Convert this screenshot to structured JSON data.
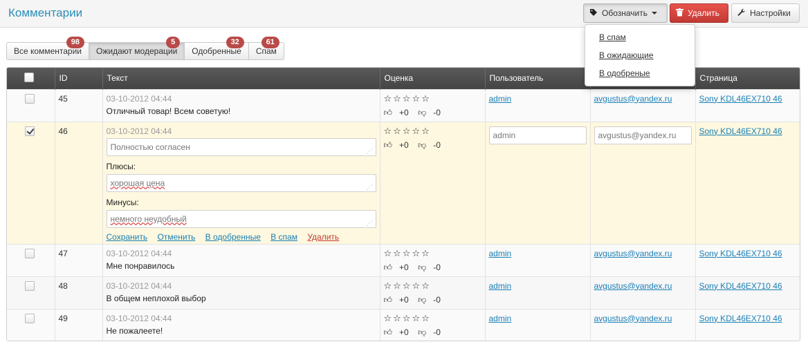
{
  "header": {
    "title": "Комментарии",
    "mark_label": "Обозначить",
    "delete_label": "Удалить",
    "settings_label": "Настройки"
  },
  "dropdown": {
    "items": [
      "В спам",
      "В ожидающие",
      "В одобреные"
    ]
  },
  "tabs": [
    {
      "label": "Все комментарии",
      "count": "98"
    },
    {
      "label": "Ожидают модерации",
      "count": "5"
    },
    {
      "label": "Одобренные",
      "count": "32"
    },
    {
      "label": "Спам",
      "count": "61"
    }
  ],
  "table": {
    "columns": [
      "ID",
      "Текст",
      "Оценка",
      "Пользователь",
      "",
      "Страница"
    ],
    "rows": [
      {
        "id": "45",
        "date": "03-10-2012 04:44",
        "text": "Отличный товар! Всем советую!",
        "stars": "☆☆☆☆☆",
        "up": "+0",
        "down": "-0",
        "user": "admin",
        "email": "avgustus@yandex.ru",
        "page": "Sony KDL46EX710 46"
      },
      {
        "id": "46",
        "date": "03-10-2012 04:44",
        "stars": "☆☆☆☆☆",
        "up": "+0",
        "down": "-0",
        "page": "Sony KDL46EX710 46"
      },
      {
        "id": "47",
        "date": "03-10-2012 04:44",
        "text": "Мне понравилось",
        "stars": "☆☆☆☆☆",
        "up": "+0",
        "down": "-0",
        "user": "admin",
        "email": "avgustus@yandex.ru",
        "page": "Sony KDL46EX710 46"
      },
      {
        "id": "48",
        "date": "03-10-2012 04:44",
        "text": "В общем неплохой выбор",
        "stars": "☆☆☆☆☆",
        "up": "+0",
        "down": "-0",
        "user": "admin",
        "email": "avgustus@yandex.ru",
        "page": "Sony KDL46EX710 46"
      },
      {
        "id": "49",
        "date": "03-10-2012 04:44",
        "text": "Не пожалеете!",
        "stars": "☆☆☆☆☆",
        "up": "+0",
        "down": "-0",
        "user": "admin",
        "email": "avgustus@yandex.ru",
        "page": "Sony KDL46EX710 46"
      }
    ],
    "edit": {
      "text_value": "Полностью согласен",
      "pros_label": "Плюсы:",
      "pros_value": "хорошая цена",
      "cons_label": "Минусы:",
      "cons_value": "немного неудобный",
      "user_value": "admin",
      "email_value": "avgustus@yandex.ru",
      "actions": {
        "save": "Сохранить",
        "cancel": "Отменить",
        "approve": "В одобренные",
        "spam": "В спам",
        "delete": "Удалить"
      }
    }
  },
  "colors": {
    "accent": "#2a8db8",
    "danger": "#c03a35",
    "badge": "#b94a48",
    "editing_row": "#fdf8df"
  }
}
